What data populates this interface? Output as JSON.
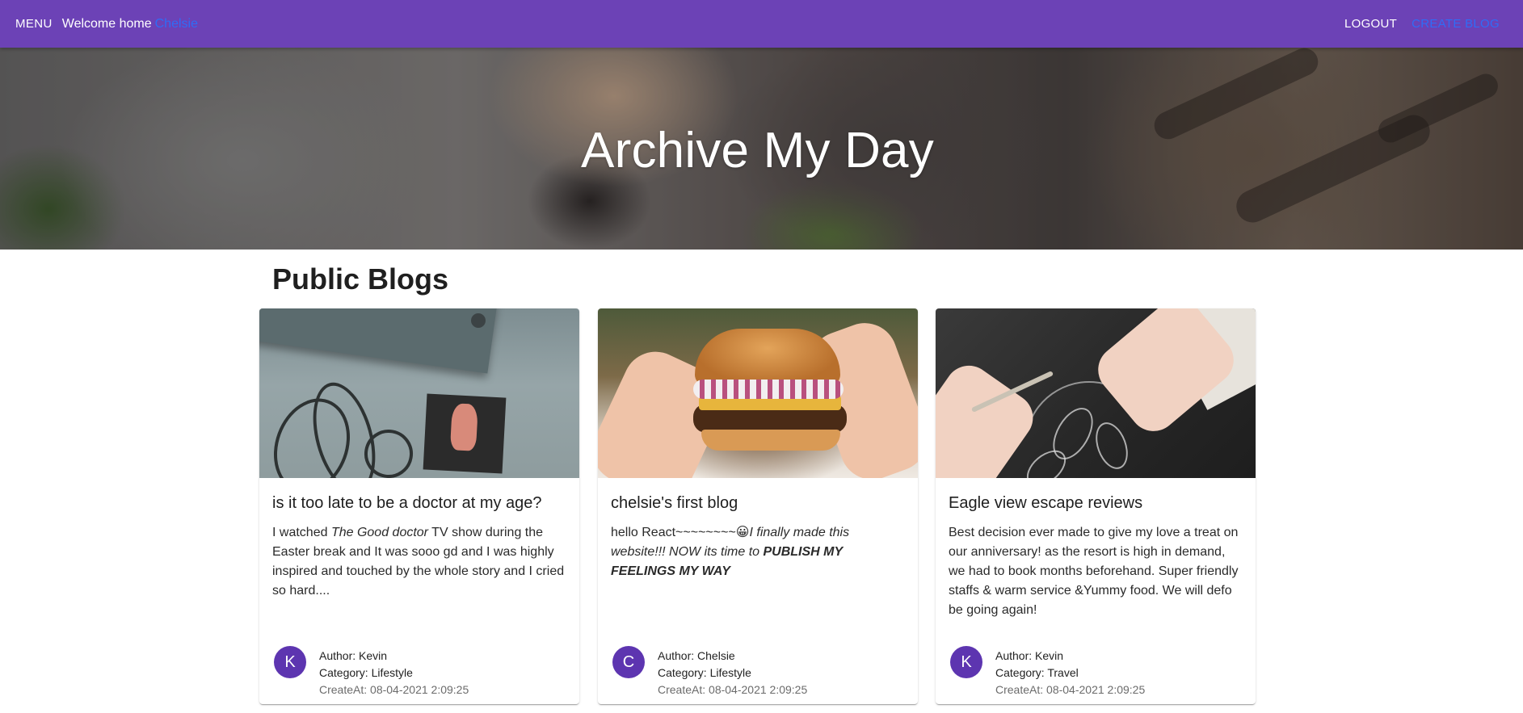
{
  "appbar": {
    "menu_label": "MENU",
    "welcome_text": "Welcome home",
    "welcome_link": "Chelsie",
    "logout_label": "LOGOUT",
    "create_label": "CREATE BLOG"
  },
  "hero": {
    "title": "Archive My Day"
  },
  "section": {
    "title": "Public Blogs"
  },
  "colors": {
    "appbar": "#6c42b6",
    "avatar": "#5d35b0",
    "link": "#2f6cf6"
  },
  "cards": [
    {
      "title": "is it too late to be a doctor at my age?",
      "body_pre": "I watched ",
      "body_em": "The Good doctor",
      "body_post": " TV show during the Easter break and It was sooo gd and I was highly inspired and touched by the whole story and I cried so hard....",
      "avatar": "K",
      "author": "Author: Kevin",
      "category": "Category: Lifestyle",
      "created": "CreateAt: 08-04-2021 2:09:25",
      "image": "wall-sticker-cat-photo"
    },
    {
      "title": "chelsie's first blog",
      "body_pre": "hello React~~~~~~~~",
      "emoji": "😀",
      "body_em": "I finally made this website!!! NOW its time to ",
      "body_strong": "PUBLISH MY FEELINGS MY WAY",
      "avatar": "C",
      "author": "Author: Chelsie",
      "category": "Category: Lifestyle",
      "created": "CreateAt: 08-04-2021 2:09:25",
      "image": "burger-photo"
    },
    {
      "title": "Eagle view escape reviews",
      "body_pre": "Best decision ever made to give my love a treat on our anniversary! as the resort is high in demand, we had to book months beforehand. Super friendly staffs & warm service &Yummy food. We will defo be going again!",
      "avatar": "K",
      "author": "Author: Kevin",
      "category": "Category: Travel",
      "created": "CreateAt: 08-04-2021 2:09:25",
      "image": "drawing-hands-photo"
    }
  ]
}
